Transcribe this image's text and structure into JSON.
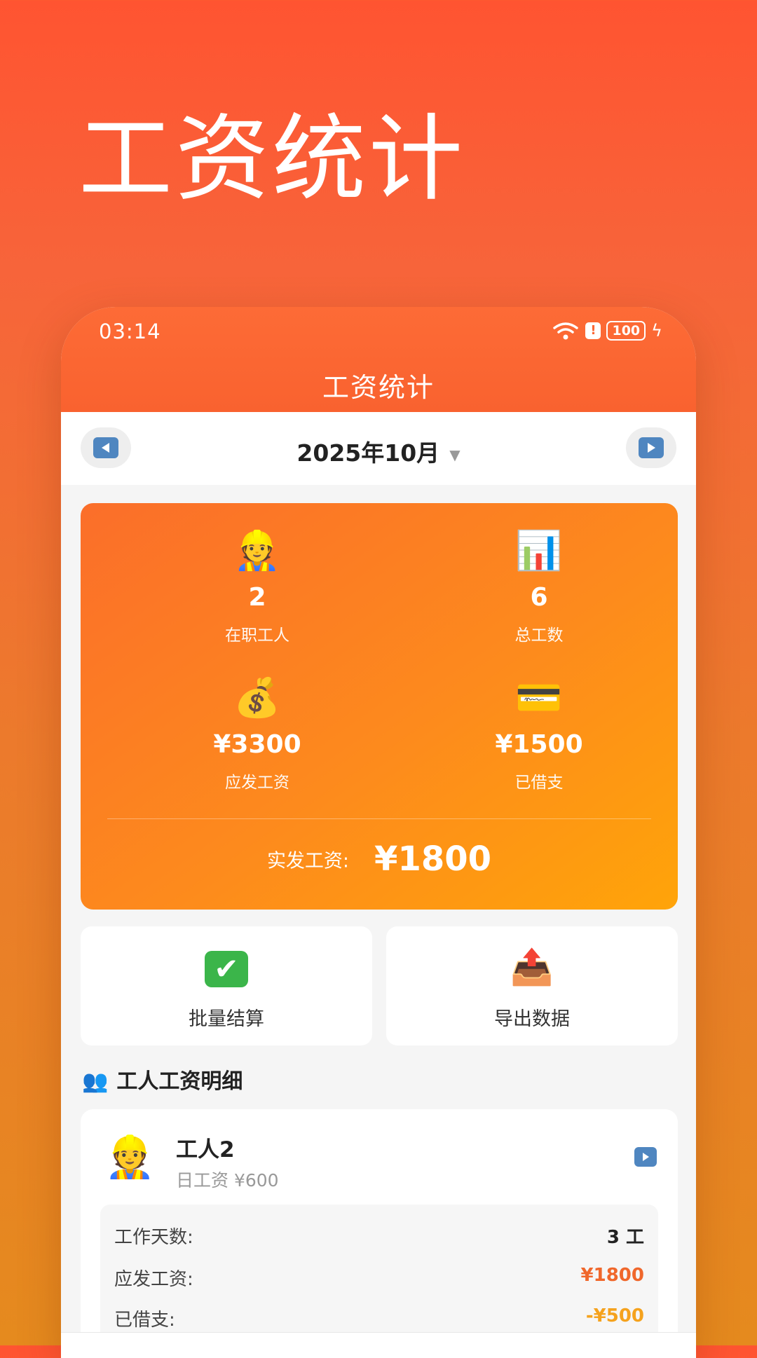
{
  "hero": {
    "title": "工资统计"
  },
  "status_bar": {
    "time": "03:14",
    "battery": "100",
    "icons": [
      "wifi-icon",
      "alert-icon",
      "battery-icon",
      "charging-bolt-icon"
    ]
  },
  "appbar": {
    "title": "工资统计"
  },
  "month_selector": {
    "label": "2025年10月",
    "caret": "▼"
  },
  "summary": {
    "workers": {
      "emoji": "👷",
      "value": "2",
      "label": "在职工人"
    },
    "total_days": {
      "emoji": "📊",
      "value": "6",
      "label": "总工数"
    },
    "payable": {
      "emoji": "💰",
      "value": "¥3300",
      "label": "应发工资"
    },
    "borrowed": {
      "emoji": "💳",
      "value": "¥1500",
      "label": "已借支"
    },
    "net_label": "实发工资:",
    "net_value": "¥1800"
  },
  "actions": {
    "batch_settle": {
      "icon": "✔",
      "label": "批量结算"
    },
    "export": {
      "emoji": "📤",
      "label": "导出数据"
    }
  },
  "section": {
    "emoji": "👥",
    "title": "工人工资明细"
  },
  "worker": {
    "emoji": "👷",
    "name": "工人2",
    "daily_wage": "日工资 ¥600",
    "rows": [
      {
        "label": "工作天数:",
        "value": "3 工"
      },
      {
        "label": "应发工资:",
        "value": "¥1800"
      },
      {
        "label": "已借支:",
        "value": "-¥500"
      }
    ]
  },
  "colors": {
    "accent": "#fb6634",
    "summary_start": "#fb6e2a",
    "summary_end": "#ffa409",
    "nav_blue": "#4f86c0",
    "amount_orange": "#f0672b",
    "amount_amber": "#f5a21d"
  }
}
